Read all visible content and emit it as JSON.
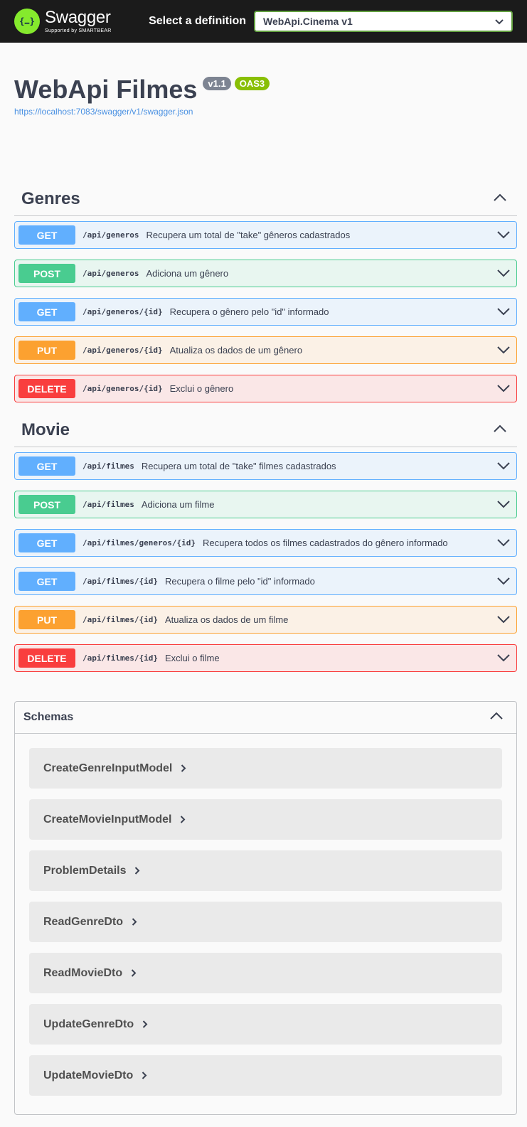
{
  "topbar": {
    "brand": "Swagger",
    "brand_sub": "Supported by SMARTBEAR",
    "definition_label": "Select a definition",
    "definition_value": "WebApi.Cinema v1"
  },
  "info": {
    "title": "WebApi Filmes",
    "version": "v1.1",
    "oas": "OAS3",
    "spec_url": "https://localhost:7083/swagger/v1/swagger.json"
  },
  "tags": [
    {
      "name": "Genres",
      "operations": [
        {
          "method": "GET",
          "path": "/api/generos",
          "summary": "Recupera um total de \"take\" gêneros cadastrados"
        },
        {
          "method": "POST",
          "path": "/api/generos",
          "summary": "Adiciona um gênero"
        },
        {
          "method": "GET",
          "path": "/api/generos/{id}",
          "summary": "Recupera o gênero pelo \"id\" informado"
        },
        {
          "method": "PUT",
          "path": "/api/generos/{id}",
          "summary": "Atualiza os dados de um gênero"
        },
        {
          "method": "DELETE",
          "path": "/api/generos/{id}",
          "summary": "Exclui o gênero"
        }
      ]
    },
    {
      "name": "Movie",
      "operations": [
        {
          "method": "GET",
          "path": "/api/filmes",
          "summary": "Recupera um total de \"take\" filmes cadastrados"
        },
        {
          "method": "POST",
          "path": "/api/filmes",
          "summary": "Adiciona um filme"
        },
        {
          "method": "GET",
          "path": "/api/filmes/generos/{id}",
          "summary": "Recupera todos os filmes cadastrados do gênero informado"
        },
        {
          "method": "GET",
          "path": "/api/filmes/{id}",
          "summary": "Recupera o filme pelo \"id\" informado"
        },
        {
          "method": "PUT",
          "path": "/api/filmes/{id}",
          "summary": "Atualiza os dados de um filme"
        },
        {
          "method": "DELETE",
          "path": "/api/filmes/{id}",
          "summary": "Exclui o filme"
        }
      ]
    }
  ],
  "schemas": {
    "title": "Schemas",
    "models": [
      "CreateGenreInputModel",
      "CreateMovieInputModel",
      "ProblemDetails",
      "ReadGenreDto",
      "ReadMovieDto",
      "UpdateGenreDto",
      "UpdateMovieDto"
    ]
  },
  "colors": {
    "get": "#61affe",
    "post": "#49cc90",
    "put": "#fca130",
    "delete": "#f93e3e",
    "brand": "#85ea2d"
  }
}
